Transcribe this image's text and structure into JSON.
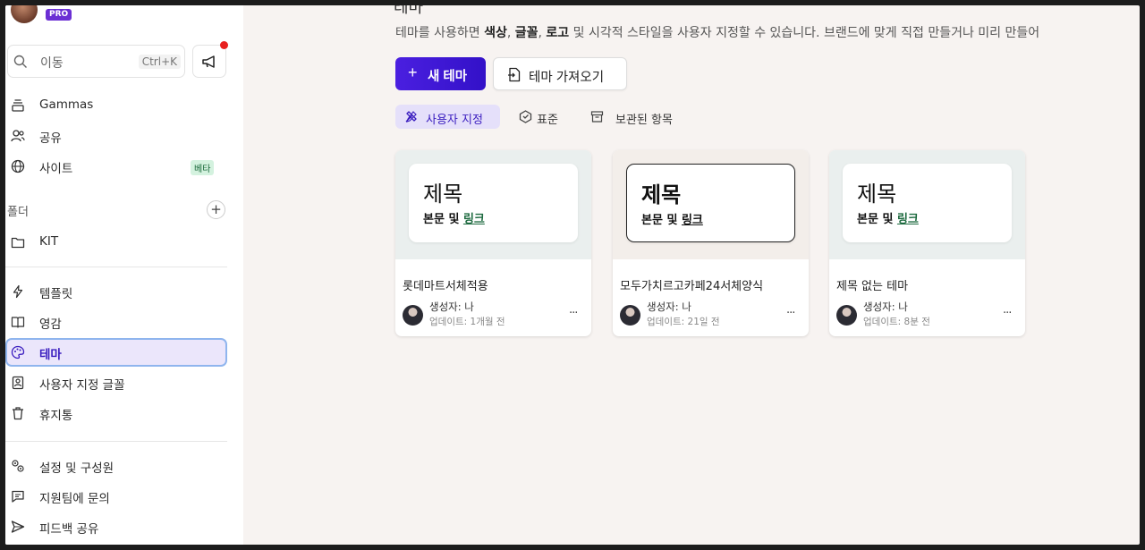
{
  "sidebar": {
    "pro_badge": "PRO",
    "search": {
      "placeholder": "이동",
      "shortcut": "Ctrl+K"
    },
    "items": [
      {
        "label": "Gammas",
        "icon": "stack-icon"
      },
      {
        "label": "공유",
        "icon": "users-icon"
      },
      {
        "label": "사이트",
        "icon": "globe-icon",
        "badge": "베타"
      }
    ],
    "folders_label": "폴더",
    "folders": [
      {
        "label": "KIT",
        "icon": "folder-icon"
      }
    ],
    "items2": [
      {
        "label": "템플릿",
        "icon": "bolt-icon"
      },
      {
        "label": "영감",
        "icon": "book-icon"
      },
      {
        "label": "테마",
        "icon": "palette-icon",
        "active": true
      },
      {
        "label": "사용자 지정 글꼴",
        "icon": "font-icon"
      },
      {
        "label": "휴지통",
        "icon": "trash-icon"
      }
    ],
    "items3": [
      {
        "label": "설정 및 구성원",
        "icon": "settings-icon"
      },
      {
        "label": "지원팀에 문의",
        "icon": "chat-icon"
      },
      {
        "label": "피드백 공유",
        "icon": "send-icon"
      }
    ]
  },
  "main": {
    "title": "테마",
    "description_parts": [
      "테마를 사용하면 ",
      "색상",
      ", ",
      "글꼴",
      ", ",
      "로고",
      " 및 시각적 스타일을 사용자 지정할 수 있습니다. 브랜드에 맞게 직접 만들거나 미리 만들어"
    ],
    "new_theme_button": "새 테마",
    "import_theme_button": "테마 가져오기",
    "tabs": [
      {
        "label": "사용자 지정",
        "active": true
      },
      {
        "label": "표준"
      },
      {
        "label": "보관된 항목"
      }
    ],
    "cards": [
      {
        "preview_title": "제목",
        "preview_body": "본문 및 ",
        "preview_link": "링크",
        "name": "롯데마트서체적용",
        "creator": "생성자: 나",
        "updated": "업데이트: 1개월 전",
        "more": "..."
      },
      {
        "preview_title": "제목",
        "preview_body": "본문 및 ",
        "preview_link": "링크",
        "name": "모두가치르고카페24서체양식",
        "creator": "생성자: 나",
        "updated": "업데이트: 21일 전",
        "more": "..."
      },
      {
        "preview_title": "제목",
        "preview_body": "본문 및 ",
        "preview_link": "링크",
        "name": "제목 없는 테마",
        "creator": "생성자: 나",
        "updated": "업데이트: 8분 전",
        "more": "..."
      }
    ]
  },
  "colors": {
    "accent": "#3a1dbf",
    "primary_button": "#4a1fe0",
    "notification": "#e8201f",
    "link_green": "#1d6a3f"
  }
}
